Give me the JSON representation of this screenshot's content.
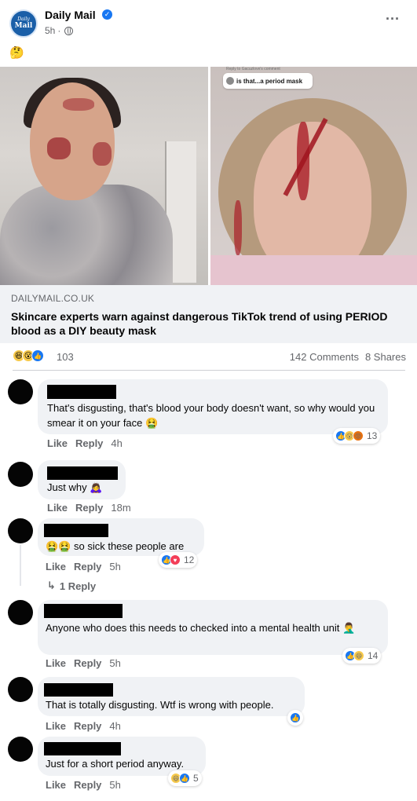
{
  "post": {
    "page_name": "Daily Mail",
    "time": "5h",
    "separator": "·",
    "post_text_emoji": "🤔",
    "logo_line1": "Daily",
    "logo_line2": "Mail",
    "image_overlay_reply": "Reply to Gacuzlove's comment",
    "image_overlay_text": "is that...a period mask"
  },
  "link_preview": {
    "domain": "DAILYMAIL.CO.UK",
    "title": "Skincare experts warn against dangerous TikTok trend of using PERIOD blood as a DIY beauty mask"
  },
  "stats": {
    "reaction_count": "103",
    "comments": "142 Comments",
    "shares": "8 Shares",
    "reactions": [
      "haha",
      "wow",
      "like"
    ]
  },
  "comments": [
    {
      "text": "That's disgusting, that's blood your body doesn't want, so why would you smear it on your face 🤮",
      "like": "Like",
      "reply": "Reply",
      "time": "4h",
      "reaction_count": "13",
      "reactions": [
        "like",
        "wow",
        "angry"
      ]
    },
    {
      "text": "Just why 🙇‍♀️",
      "like": "Like",
      "reply": "Reply",
      "time": "18m"
    },
    {
      "text": "🤮🤮 so sick these people are",
      "like": "Like",
      "reply": "Reply",
      "time": "5h",
      "reaction_count": "12",
      "reactions": [
        "like",
        "love"
      ],
      "replies_link": "1 Reply"
    },
    {
      "text": "Anyone who does this needs to checked into a mental health unit 🤦‍♂️",
      "like": "Like",
      "reply": "Reply",
      "time": "5h",
      "reaction_count": "14",
      "reactions": [
        "like",
        "haha"
      ]
    },
    {
      "text": "That is totally disgusting. Wtf is wrong with people.",
      "like": "Like",
      "reply": "Reply",
      "time": "4h",
      "reactions": [
        "like"
      ]
    },
    {
      "text": "Just for a short period anyway.",
      "like": "Like",
      "reply": "Reply",
      "time": "5h",
      "reaction_count": "5",
      "reactions": [
        "haha",
        "like"
      ]
    }
  ],
  "icons": {
    "verified": "verified-badge-icon",
    "globe": "globe-icon",
    "more": "more-options-icon",
    "reply_arrow": "reply-arrow-icon"
  },
  "colors": {
    "facebook_blue": "#1877f2",
    "bubble_bg": "#f0f2f5",
    "secondary_text": "#65676b"
  }
}
